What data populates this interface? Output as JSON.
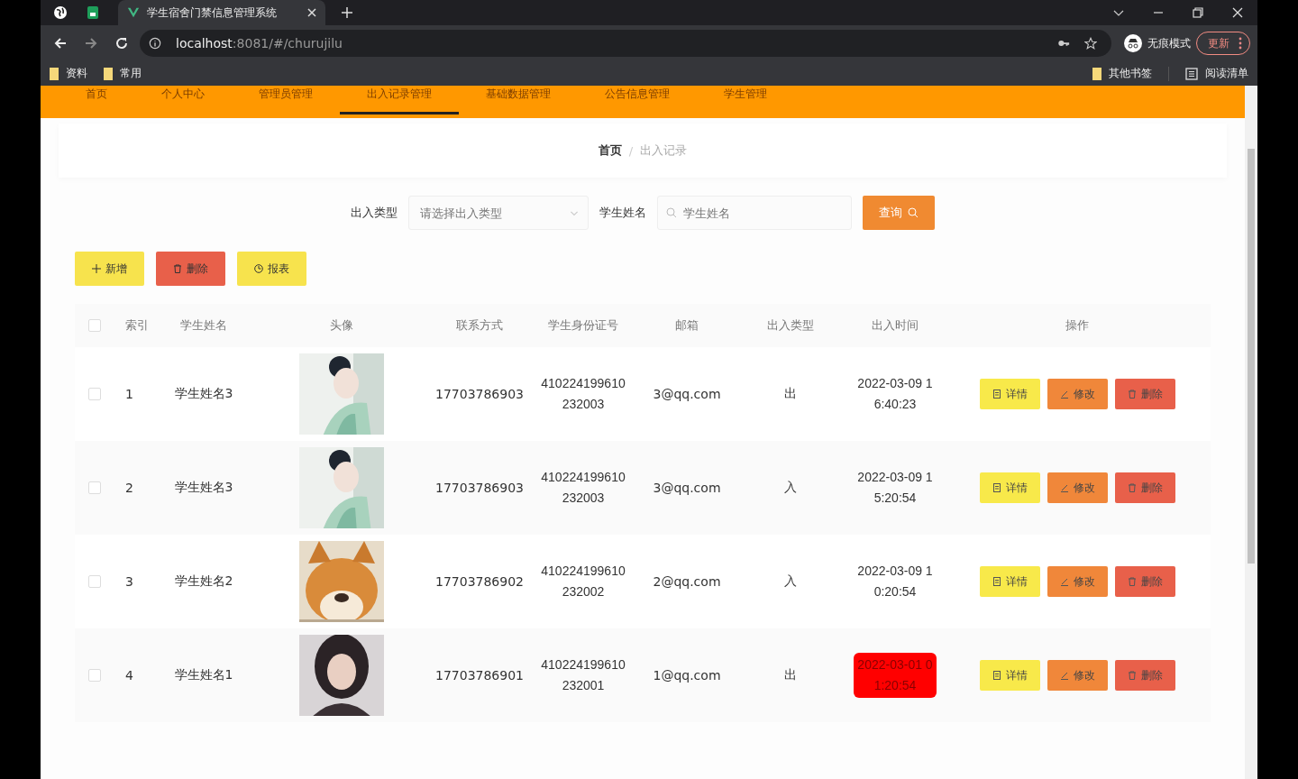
{
  "browser": {
    "tabs": [
      {
        "title": "学生宿舍门禁信息管理系统",
        "selected": true
      }
    ],
    "address": {
      "host": "localhost",
      "path": ":8081/#/churujilu"
    },
    "profile": "无痕模式",
    "update": "更新",
    "bookmarks": [
      "资料",
      "常用"
    ],
    "right_bookmarks": [
      {
        "label": "其他书签",
        "kind": "folder"
      },
      {
        "label": "阅读清单",
        "kind": "list"
      }
    ]
  },
  "nav": [
    {
      "label": "首页",
      "selected": false
    },
    {
      "label": "个人中心",
      "selected": false
    },
    {
      "label": "管理员管理",
      "selected": false
    },
    {
      "label": "出入记录管理",
      "selected": true
    },
    {
      "label": "基础数据管理",
      "selected": false
    },
    {
      "label": "公告信息管理",
      "selected": false
    },
    {
      "label": "学生管理",
      "selected": false
    }
  ],
  "breadcrumb": [
    "首页",
    "出入记录"
  ],
  "breadcrumb_separator": "/",
  "search": {
    "fields": [
      {
        "label": "出入类型",
        "placeholder": "请选择出入类型",
        "kind": "select"
      },
      {
        "label": "学生姓名",
        "placeholder": "学生姓名",
        "kind": "text"
      }
    ],
    "button": "查询"
  },
  "actions": [
    {
      "label": "新增",
      "kind": "add"
    },
    {
      "label": "删除",
      "kind": "delete"
    },
    {
      "label": "报表",
      "kind": "report"
    }
  ],
  "table": {
    "select_all_checked": false,
    "columns": [
      "索引",
      "学生姓名",
      "头像",
      "联系方式",
      "学生身份证号",
      "邮箱",
      "出入类型",
      "出入时间",
      "操作"
    ],
    "rows": [
      {
        "checked": false,
        "index": "1",
        "name": "学生姓名3",
        "avatar": {
          "kind": "picture"
        },
        "phone": "17703786903",
        "id_number": "410224199610232003",
        "email": "3@qq.com",
        "direction": "出",
        "time": "2022-03-09 16:40:23",
        "highlighted": false,
        "buttons": [
          {
            "label": "详情",
            "kind": "detail"
          },
          {
            "label": "修改",
            "kind": "edit"
          },
          {
            "label": "删除",
            "kind": "delete"
          }
        ]
      },
      {
        "checked": false,
        "index": "2",
        "name": "学生姓名3",
        "avatar": {
          "kind": "picture"
        },
        "phone": "17703786903",
        "id_number": "410224199610232003",
        "email": "3@qq.com",
        "direction": "入",
        "time": "2022-03-09 15:20:54",
        "highlighted": false,
        "buttons": [
          {
            "label": "详情",
            "kind": "detail"
          },
          {
            "label": "修改",
            "kind": "edit"
          },
          {
            "label": "删除",
            "kind": "delete"
          }
        ]
      },
      {
        "checked": false,
        "index": "3",
        "name": "学生姓名2",
        "avatar": {
          "kind": "picture"
        },
        "phone": "17703786902",
        "id_number": "410224199610232002",
        "email": "2@qq.com",
        "direction": "入",
        "time": "2022-03-09 10:20:54",
        "highlighted": false,
        "buttons": [
          {
            "label": "详情",
            "kind": "detail"
          },
          {
            "label": "修改",
            "kind": "edit"
          },
          {
            "label": "删除",
            "kind": "delete"
          }
        ]
      },
      {
        "checked": false,
        "index": "4",
        "name": "学生姓名1",
        "avatar": {
          "kind": "picture"
        },
        "phone": "17703786901",
        "id_number": "410224199610232001",
        "email": "1@qq.com",
        "direction": "出",
        "time": "2022-03-01 01:20:54",
        "highlighted": true,
        "buttons": [
          {
            "label": "详情",
            "kind": "detail"
          },
          {
            "label": "修改",
            "kind": "edit"
          },
          {
            "label": "删除",
            "kind": "delete"
          }
        ]
      }
    ]
  }
}
